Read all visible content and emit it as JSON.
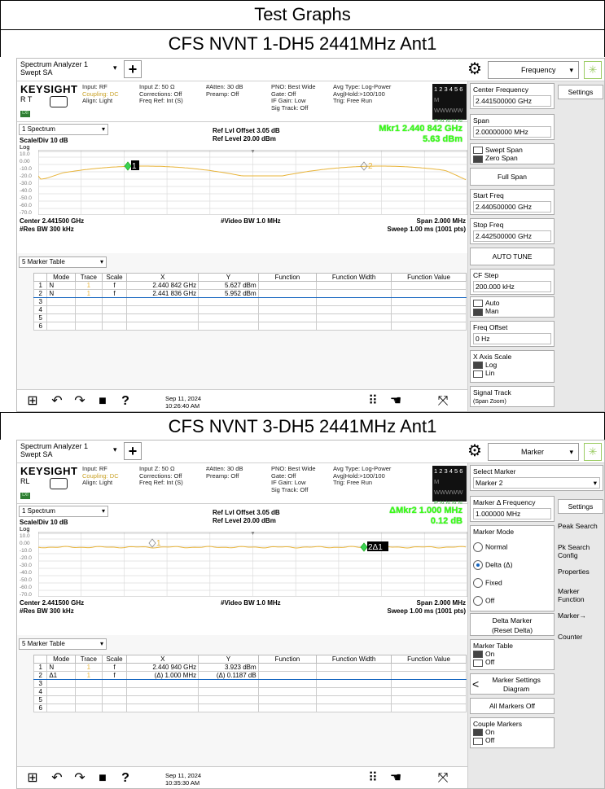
{
  "doc": {
    "title": "Test Graphs",
    "section1": "CFS NVNT 1-DH5 2441MHz Ant1",
    "section2": "CFS NVNT 3-DH5 2441MHz Ant1"
  },
  "shots": [
    {
      "app_title_line1": "Spectrum Analyzer 1",
      "app_title_line2": "Swept SA",
      "mode": "Frequency",
      "brand": "KEYSIGHT",
      "rt_label": "R  T",
      "input": "Input: RF",
      "input_hl": "Coupling: DC",
      "align": "Align: Light",
      "input_z": "Input Z: 50 Ω",
      "corrections": "Corrections: Off",
      "freq_ref": "Freq Ref: Int (S)",
      "atten": "#Atten: 30 dB",
      "preamp": "Preamp: Off",
      "pno": "PNO: Best Wide",
      "gate": "Gate: Off",
      "if_gain": "IF Gain: Low",
      "sig_track": "Sig Track: Off",
      "avg_type": "Avg Type: Log-Power",
      "avg_hold": "Avg|Hold:>100/100",
      "trig": "Trig: Free Run",
      "trace_r1": "1 2 3 4 5 6",
      "trace_r2": "M WWWWW",
      "trace_r3": "P N N N N N",
      "spectrum_sel": "1 Spectrum",
      "scale": "Scale/Div 10 dB",
      "log": "Log",
      "ref_offset": "Ref Lvl Offset 3.05 dB",
      "ref_level": "Ref Level 20.00 dBm",
      "mkr_line1": "Mkr1  2.440 842 GHz",
      "mkr_line2": "5.63 dBm",
      "y_ticks": [
        "10.0",
        "0.00",
        "-10.0",
        "-20.0",
        "-30.0",
        "-40.0",
        "-50.0",
        "-60.0",
        "-70.0"
      ],
      "marker_a": "1",
      "marker_b": "2",
      "center": "Center 2.441500 GHz",
      "res_bw": "#Res BW 300 kHz",
      "video_bw": "#Video BW 1.0 MHz",
      "span": "Span 2.000 MHz",
      "sweep": "Sweep 1.00 ms (1001 pts)",
      "table_sel": "5 Marker Table",
      "table_headers": [
        "",
        "Mode",
        "Trace",
        "Scale",
        "X",
        "Y",
        "Function",
        "Function Width",
        "Function Value"
      ],
      "table_rows": [
        [
          "1",
          "N",
          "1",
          "f",
          "2.440 842 GHz",
          "5.627 dBm",
          "",
          "",
          ""
        ],
        [
          "2",
          "N",
          "1",
          "f",
          "2.441 836 GHz",
          "5.952 dBm",
          "",
          "",
          ""
        ],
        [
          "3",
          "",
          "",
          "",
          "",
          "",
          "",
          "",
          ""
        ],
        [
          "4",
          "",
          "",
          "",
          "",
          "",
          "",
          "",
          ""
        ],
        [
          "5",
          "",
          "",
          "",
          "",
          "",
          "",
          "",
          ""
        ],
        [
          "6",
          "",
          "",
          "",
          "",
          "",
          "",
          "",
          ""
        ]
      ],
      "date": "Sep 11, 2024",
      "time": "10:26:40 AM",
      "panel": {
        "center_freq_label": "Center Frequency",
        "center_freq_val": "2.441500000 GHz",
        "settings": "Settings",
        "span_label": "Span",
        "span_val": "2.00000000 MHz",
        "swept_span": "Swept Span",
        "zero_span": "Zero Span",
        "full_span": "Full Span",
        "start_label": "Start Freq",
        "start_val": "2.440500000 GHz",
        "stop_label": "Stop Freq",
        "stop_val": "2.442500000 GHz",
        "auto_tune": "AUTO TUNE",
        "cf_step": "CF Step",
        "cf_step_val": "200.000 kHz",
        "auto": "Auto",
        "man": "Man",
        "freq_offset": "Freq Offset",
        "freq_offset_val": "0 Hz",
        "x_axis": "X Axis Scale",
        "log": "Log",
        "lin": "Lin",
        "signal_track": "Signal Track",
        "span_zoom": "(Span Zoom)"
      },
      "trace_color": "#e8b43a"
    },
    {
      "app_title_line1": "Spectrum Analyzer 1",
      "app_title_line2": "Swept SA",
      "mode": "Marker",
      "brand": "KEYSIGHT",
      "rt_label": "RL",
      "input": "Input: RF",
      "input_hl": "Coupling: DC",
      "align": "Align: Light",
      "input_z": "Input Z: 50 Ω",
      "corrections": "Corrections: Off",
      "freq_ref": "Freq Ref: Int (S)",
      "atten": "#Atten: 30 dB",
      "preamp": "Preamp: Off",
      "pno": "PNO: Best Wide",
      "gate": "Gate: Off",
      "if_gain": "IF Gain: Low",
      "sig_track": "Sig Track: Off",
      "avg_type": "Avg Type: Log-Power",
      "avg_hold": "Avg|Hold:>100/100",
      "trig": "Trig: Free Run",
      "trace_r1": "1 2 3 4 5 6",
      "trace_r2": "M WWWWW",
      "trace_r3": "P N N N N N",
      "spectrum_sel": "1 Spectrum",
      "scale": "Scale/Div 10 dB",
      "log": "Log",
      "ref_offset": "Ref Lvl Offset 3.05 dB",
      "ref_level": "Ref Level 20.00 dBm",
      "mkr_line1": "ΔMkr2  1.000 MHz",
      "mkr_line2": "0.12 dB",
      "y_ticks": [
        "10.0",
        "0.00",
        "-10.0",
        "-20.0",
        "-30.0",
        "-40.0",
        "-50.0",
        "-60.0",
        "-70.0"
      ],
      "marker_a": "1",
      "marker_b": "2Δ1",
      "center": "Center 2.441500 GHz",
      "res_bw": "#Res BW 300 kHz",
      "video_bw": "#Video BW 1.0 MHz",
      "span": "Span 2.000 MHz",
      "sweep": "Sweep 1.00 ms (1001 pts)",
      "table_sel": "5 Marker Table",
      "table_headers": [
        "",
        "Mode",
        "Trace",
        "Scale",
        "X",
        "Y",
        "Function",
        "Function Width",
        "Function Value"
      ],
      "table_rows": [
        [
          "1",
          "N",
          "1",
          "f",
          "2.440 940 GHz",
          "3.923 dBm",
          "",
          "",
          ""
        ],
        [
          "2",
          "Δ1",
          "1",
          "f",
          "(Δ)        1.000 MHz",
          "(Δ)   0.1187 dB",
          "",
          "",
          ""
        ],
        [
          "3",
          "",
          "",
          "",
          "",
          "",
          "",
          "",
          ""
        ],
        [
          "4",
          "",
          "",
          "",
          "",
          "",
          "",
          "",
          ""
        ],
        [
          "5",
          "",
          "",
          "",
          "",
          "",
          "",
          "",
          ""
        ],
        [
          "6",
          "",
          "",
          "",
          "",
          "",
          "",
          "",
          ""
        ]
      ],
      "date": "Sep 11, 2024",
      "time": "10:35:30 AM",
      "panel": {
        "select_marker": "Select Marker",
        "select_marker_val": "Marker 2",
        "marker_delta_freq": "Marker Δ Frequency",
        "marker_delta_val": "1.000000 MHz",
        "settings": "Settings",
        "marker_mode": "Marker Mode",
        "normal": "Normal",
        "delta": "Delta (Δ)",
        "fixed": "Fixed",
        "off": "Off",
        "delta_marker": "Delta Marker",
        "reset_delta": "(Reset Delta)",
        "marker_table": "Marker Table",
        "on": "On",
        "off2": "Off",
        "marker_settings": "Marker Settings",
        "diagram": "Diagram",
        "all_markers_off": "All Markers Off",
        "couple_markers": "Couple Markers",
        "peak_search": "Peak Search",
        "pk_search_config": "Pk Search Config",
        "properties": "Properties",
        "marker_function": "Marker Function",
        "marker_to": "Marker→",
        "counter": "Counter"
      },
      "trace_color": "#e8b43a"
    }
  ]
}
